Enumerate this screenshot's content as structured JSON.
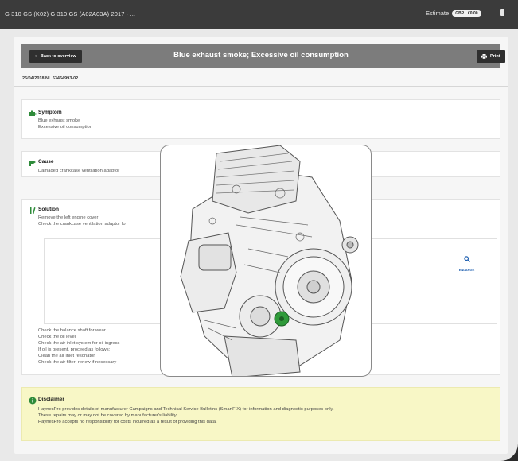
{
  "titlebar": {
    "vehicle": "G 310 GS (K02) G 310 GS (A02A03A) 2017 - ...",
    "estimate_label": "Estimate",
    "currency": "GBP",
    "amount": "€0.00"
  },
  "header": {
    "back_label": "Back to overview",
    "title": "Blue exhaust smoke; Excessive oil consumption",
    "print_label": "Print"
  },
  "document": {
    "date_ref": "26/04/2018 NL 63464993-02"
  },
  "symptom": {
    "title": "Symptom",
    "lines": [
      "Blue exhaust smoke",
      "Excessive oil consumption"
    ]
  },
  "cause": {
    "title": "Cause",
    "lines": [
      "Damaged crankcase ventilation adaptor"
    ]
  },
  "solution": {
    "title": "Solution",
    "steps_before": [
      "Remove the left engine cover",
      "Check the crankcase ventilation adaptor fo"
    ],
    "enlarge_label": "ENLARGE",
    "steps_after": [
      "Check the balance shaft for wear",
      "Check the oil level",
      "Check the air inlet system for oil ingress",
      "If oil is present, proceed as follows:",
      "Clean the air inlet resonator",
      "Check the air filter; renew if necessary"
    ]
  },
  "disclaimer": {
    "title": "Disclaimer",
    "lines": [
      "HaynesPro provides details of manufacturer Campaigns and Technical Service Bulletins (SmartFIX) for information and diagnostic purposes only.",
      "These repairs may or may not be covered by manufacturer's liability.",
      "HaynesPro accepts no responsibility for costs incurred as a result of providing this data."
    ]
  },
  "colors": {
    "titlebar": "#3b3b3b",
    "headerbar": "#7c7c7c",
    "button": "#2f2f2f",
    "icon_green": "#2e8b3a",
    "disclaimer_bg": "#f8f7c6",
    "highlight_part": "#2f9a3a"
  },
  "icons": {
    "symptom": "engine-check-icon",
    "cause": "wrench-icon",
    "solution": "tools-icon",
    "disclaimer": "info-circle-icon",
    "print": "printer-icon",
    "back": "chevron-left-icon",
    "enlarge": "magnifier-icon"
  }
}
